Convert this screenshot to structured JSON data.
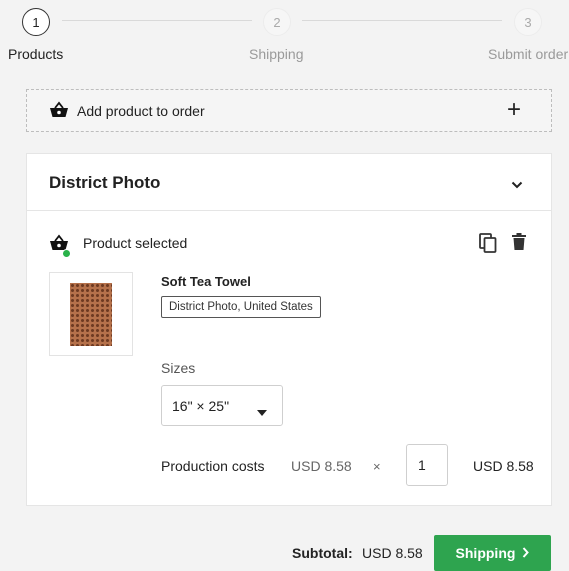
{
  "stepper": {
    "steps": [
      {
        "number": "1",
        "label": "Products"
      },
      {
        "number": "2",
        "label": "Shipping"
      },
      {
        "number": "3",
        "label": "Submit order"
      }
    ]
  },
  "add_product": {
    "label": "Add product to order",
    "icon": "basket-icon",
    "action_icon": "plus-icon"
  },
  "store": {
    "title": "District Photo",
    "collapse_icon": "chevron-down-icon"
  },
  "selection": {
    "label": "Product selected",
    "status_color": "#29b24a"
  },
  "product": {
    "name": "Soft Tea Towel",
    "tag": "District Photo, United States",
    "sizes_label": "Sizes",
    "size_selected": "16\" × 25\"",
    "production_label": "Production costs",
    "unit_cost": "USD 8.58",
    "times": "×",
    "quantity": "1",
    "line_total": "USD 8.58"
  },
  "footer": {
    "subtotal_label": "Subtotal:",
    "subtotal_value": "USD 8.58",
    "next_button": "Shipping",
    "accent_color": "#2ea44f"
  }
}
